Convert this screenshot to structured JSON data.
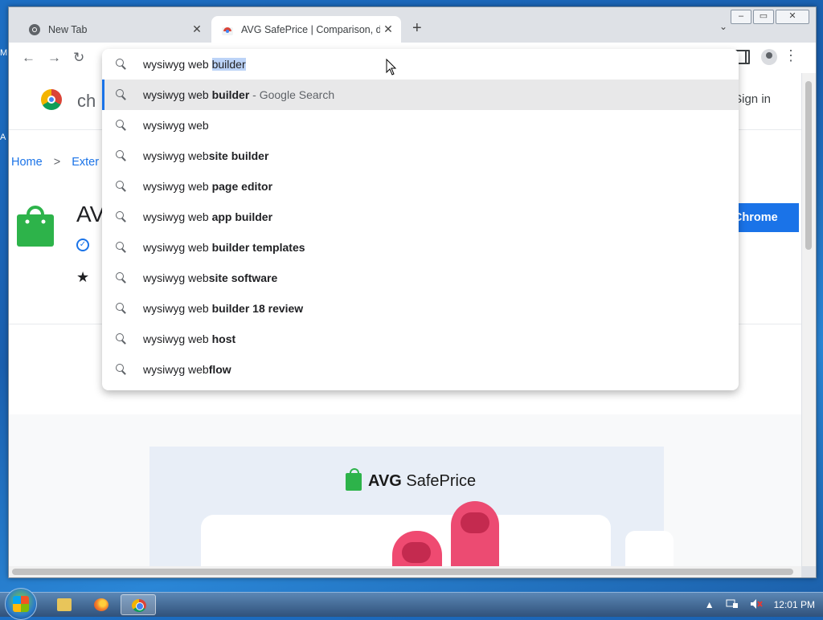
{
  "desktop": {
    "label_top": "M",
    "label_bottom": "A"
  },
  "window": {
    "tabs": [
      {
        "title": "New Tab",
        "close": "✕"
      },
      {
        "title": "AVG SafePrice | Comparison, deal",
        "close": "✕"
      }
    ],
    "new_tab": "+",
    "tab_search": "⌄",
    "controls": {
      "minimize": "‒",
      "maximize": "▭",
      "close": "✕"
    }
  },
  "toolbar": {
    "back": "←",
    "forward": "→",
    "reload": "↻",
    "menu": "⋮"
  },
  "omnibox": {
    "typed": "wysiwyg web",
    "autocompleted": "builder",
    "suggestions": [
      {
        "plain": "wysiwyg web ",
        "bold": "builder",
        "hint": " - Google Search",
        "active": true
      },
      {
        "plain": "wysiwyg web",
        "bold": "",
        "hint": ""
      },
      {
        "plain": "wysiwyg web",
        "bold": "site builder",
        "hint": ""
      },
      {
        "plain": "wysiwyg web ",
        "bold": "page editor",
        "hint": ""
      },
      {
        "plain": "wysiwyg web ",
        "bold": "app builder",
        "hint": ""
      },
      {
        "plain": "wysiwyg web ",
        "bold": "builder templates",
        "hint": ""
      },
      {
        "plain": "wysiwyg web",
        "bold": "site software",
        "hint": ""
      },
      {
        "plain": "wysiwyg web ",
        "bold": "builder 18 review",
        "hint": ""
      },
      {
        "plain": "wysiwyg web ",
        "bold": "host",
        "hint": ""
      },
      {
        "plain": "wysiwyg web",
        "bold": "flow",
        "hint": ""
      }
    ]
  },
  "page": {
    "store_name": "ch",
    "gear": "⚙",
    "sign_in": "Sign in",
    "breadcrumb": {
      "home": "Home",
      "sep": ">",
      "extensions": "Exter"
    },
    "ext_title": "AV",
    "verified": "✓",
    "star": "★",
    "add_button": "o Chrome",
    "promo": {
      "brand_bold": "AVG",
      "brand_rest": " SafePrice"
    }
  },
  "taskbar": {
    "tray_up": "▲",
    "clock": "12:01 PM"
  },
  "colors": {
    "accent": "#1a73e8",
    "selection": "#bcd3f7",
    "avg_green": "#2db34a"
  }
}
